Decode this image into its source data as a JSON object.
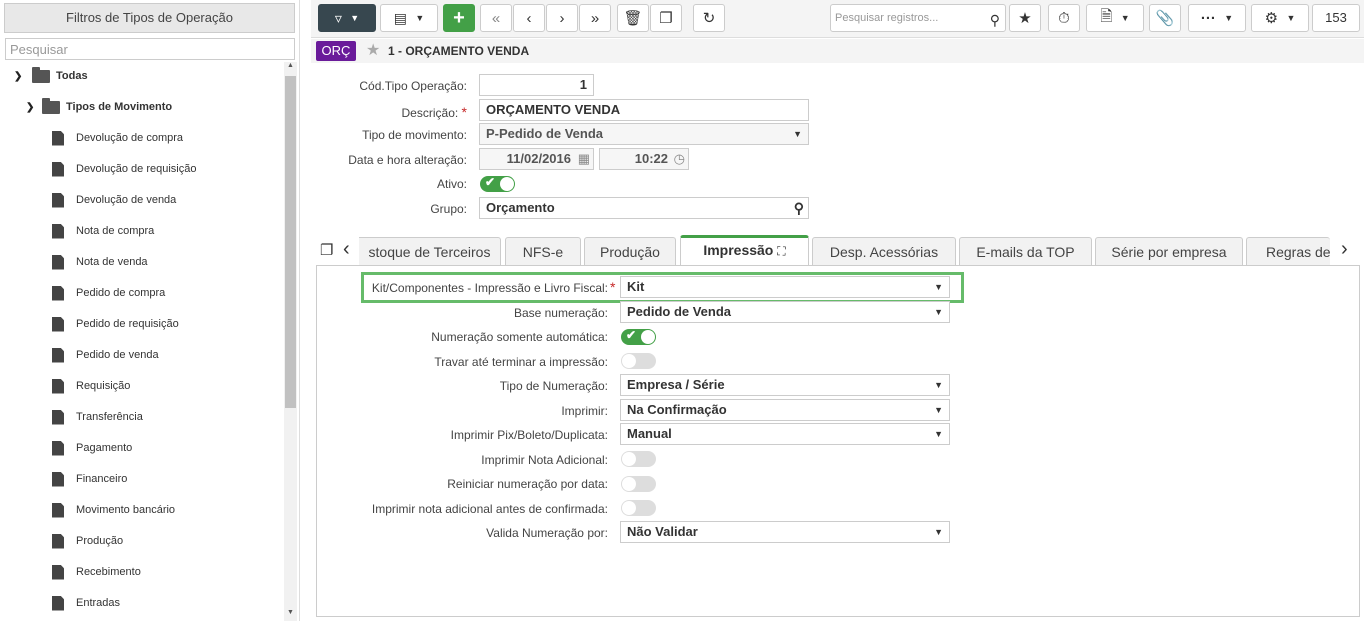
{
  "left_panel": {
    "title": "Filtros de Tipos de Operação",
    "search_placeholder": "Pesquisar",
    "root": "Todas",
    "group": "Tipos de Movimento",
    "items": [
      "Devolução de compra",
      "Devolução de requisição",
      "Devolução de venda",
      "Nota de compra",
      "Nota de venda",
      "Pedido de compra",
      "Pedido de requisição",
      "Pedido de venda",
      "Requisição",
      "Transferência",
      "Pagamento",
      "Financeiro",
      "Movimento bancário",
      "Produção",
      "Recebimento",
      "Entradas"
    ]
  },
  "toolbar": {
    "search_placeholder": "Pesquisar registros...",
    "record_count": "153"
  },
  "record": {
    "badge": "ORÇ",
    "title": "1 - ORÇAMENTO VENDA"
  },
  "form": {
    "cod_label": "Cód.Tipo Operação:",
    "cod_value": "1",
    "desc_label": "Descrição:",
    "desc_value": "ORÇAMENTO VENDA",
    "tipo_mov_label": "Tipo de movimento:",
    "tipo_mov_value": "P-Pedido de Venda",
    "data_label": "Data e hora alteração:",
    "data_value": "11/02/2016",
    "hora_value": "10:22",
    "ativo_label": "Ativo:",
    "grupo_label": "Grupo:",
    "grupo_value": "Orçamento"
  },
  "tabs": [
    "stoque de Terceiros",
    "NFS-e",
    "Produção",
    "Impressão",
    "Desp. Acessórias",
    "E-mails da TOP",
    "Série por empresa",
    "Regras de"
  ],
  "impressao": {
    "kit_label": "Kit/Componentes - Impressão e Livro Fiscal:",
    "kit_value": "Kit",
    "base_label": "Base numeração:",
    "base_value": "Pedido de Venda",
    "num_auto_label": "Numeração somente automática:",
    "travar_label": "Travar até terminar a impressão:",
    "tipo_num_label": "Tipo de Numeração:",
    "tipo_num_value": "Empresa / Série",
    "imprimir_label": "Imprimir:",
    "imprimir_value": "Na Confirmação",
    "pix_label": "Imprimir Pix/Boleto/Duplicata:",
    "pix_value": "Manual",
    "nota_ad_label": "Imprimir Nota Adicional:",
    "reiniciar_label": "Reiniciar numeração por data:",
    "nota_ad_antes_label": "Imprimir nota adicional antes de confirmada:",
    "valida_label": "Valida Numeração por:",
    "valida_value": "Não Validar"
  }
}
